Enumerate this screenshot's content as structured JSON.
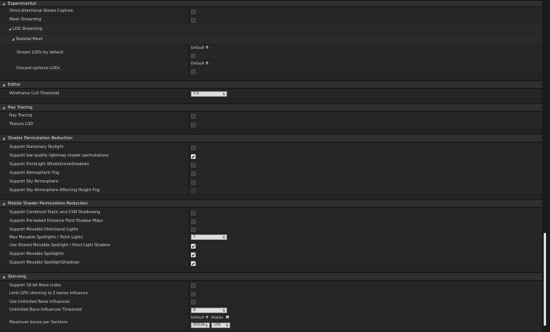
{
  "experimental": {
    "title": "Experimental",
    "omni_stereo": "Omni-directional Stereo Capture",
    "mesh_streaming": "Mesh Streaming",
    "lod_streaming": "LOD Streaming",
    "skeletal_mesh": "Skeletal Mesh",
    "stream_lods": "Stream LODs by default",
    "discard_lods": "Discard optional LODs",
    "default_label": "Default"
  },
  "editor": {
    "title": "Editor",
    "wireframe_cull": "Wireframe Cull Threshold",
    "wireframe_cull_value": "5.0"
  },
  "ray_tracing": {
    "title": "Ray Tracing",
    "ray_tracing": "Ray Tracing",
    "texture_lod": "Texture LOD"
  },
  "shader_perm": {
    "title": "Shader Permutation Reduction",
    "items": [
      "Support Stationary Skylight",
      "Support low quality lightmap shader permutations",
      "Support PointLight WholeSceneShadows",
      "Support Atmospheric Fog",
      "Support Sky Atmosphere",
      "Support Sky Atmosphere Affecting Height Fog"
    ]
  },
  "mobile_shader": {
    "title": "Mobile Shader Permutation Reduction",
    "combined_static": "Support Combined Static and CSM Shadowing",
    "distance_field": "Support Pre-baked Distance Field Shadow Maps",
    "movable_dir": "Support Movable Directional Lights",
    "max_movable": "Max Movable Spotlights / Point Lights",
    "max_movable_value": "1",
    "shared_shaders": "Use Shared Movable Spotlight / Point Light Shaders",
    "movable_spot": "Support Movable Spotlights",
    "movable_spot_shadows": "Support Movable SpotlightShadows"
  },
  "skinning": {
    "title": "Skinning",
    "bone16": "Support 16-bit Bone Index",
    "limit_gpu": "Limit GPU skinning to 2 bones influence",
    "unlimited_bone": "Use Unlimited Bone Influences",
    "unlimited_threshold": "Unlimited Bone Influences Threshold",
    "unlimited_threshold_value": "8",
    "max_bones": "Maximum bones per Sections",
    "max_bones_default_label": "Default",
    "max_bones_mobile_label": "Mobile",
    "max_bones_default_value": "65536",
    "max_bones_mobile_value": "256"
  }
}
